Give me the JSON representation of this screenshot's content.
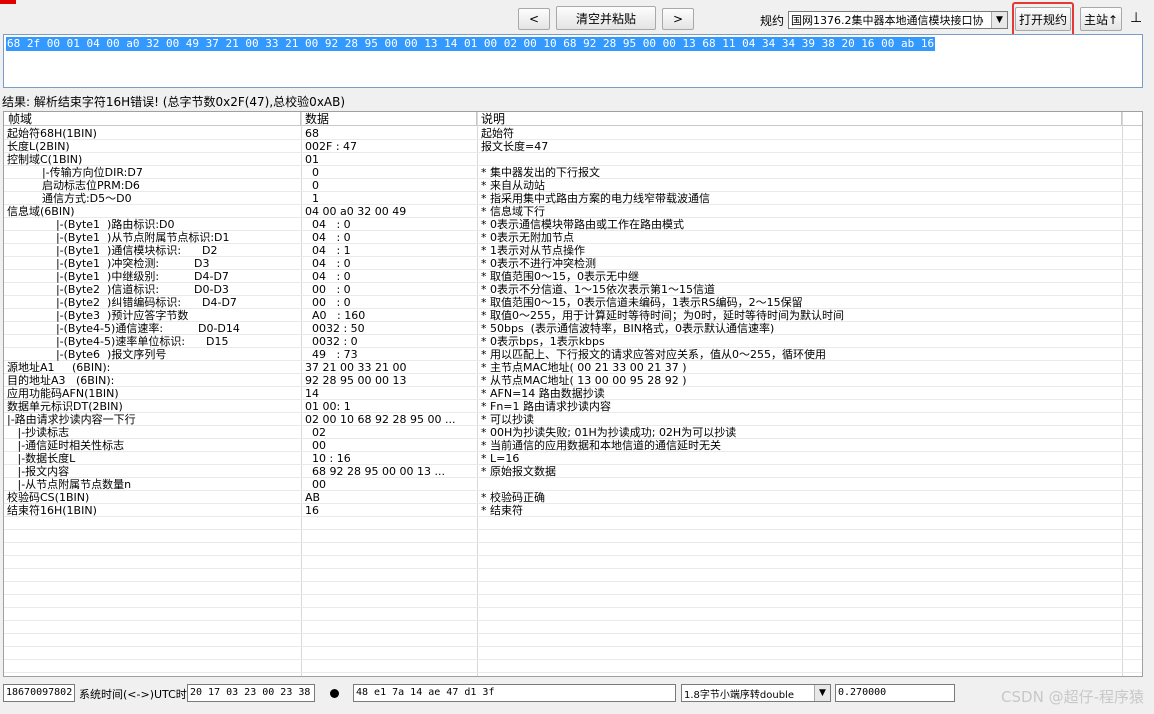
{
  "toolbar": {
    "prev_label": "<",
    "clear_paste_label": "清空并粘贴",
    "next_label": ">",
    "protocol_label": "规约",
    "protocol_value": "国网1376.2集中器本地通信模块接口协",
    "open_protocol_label": "打开规约",
    "main_station_label": "主站↑",
    "pin_label": "⊥"
  },
  "raw": {
    "hex": "68 2f 00 01 04 00 a0 32 00 49 37 21 00 33 21 00 92 28 95 00 00 13 14 01 00 02 00 10 68 92 28 95 00 00 13 68 11 04 34 34 39 38 20 16 00 ab 16"
  },
  "result": {
    "text": "结果: 解析结束字符16H错误! (总字节数0x2F(47),总校验0xAB)"
  },
  "grid": {
    "columns": [
      "帧域",
      "数据",
      "说明"
    ],
    "rows": [
      [
        "起始符68H(1BIN)",
        "68",
        "起始符"
      ],
      [
        "长度L(2BIN)",
        "002F : 47",
        "报文长度=47"
      ],
      [
        "控制域C(1BIN)",
        "01",
        ""
      ],
      [
        "          |-传输方向位DIR:D7",
        "  0",
        "* 集中器发出的下行报文"
      ],
      [
        "          启动标志位PRM:D6",
        "  0",
        "* 来自从动站"
      ],
      [
        "          通信方式:D5～D0",
        "  1",
        "* 指采用集中式路由方案的电力线窄带载波通信"
      ],
      [
        "信息域(6BIN)",
        "04 00 a0 32 00 49",
        "* 信息域下行"
      ],
      [
        "              |-(Byte1  )路由标识:D0",
        "  04   : 0",
        "* 0表示通信模块带路由或工作在路由模式"
      ],
      [
        "              |-(Byte1  )从节点附属节点标识:D1",
        "  04   : 0",
        "* 0表示无附加节点"
      ],
      [
        "              |-(Byte1  )通信模块标识:      D2",
        "  04   : 1",
        "* 1表示对从节点操作"
      ],
      [
        "              |-(Byte1  )冲突检测:          D3",
        "  04   : 0",
        "* 0表示不进行冲突检测"
      ],
      [
        "              |-(Byte1  )中继级别:          D4-D7",
        "  04   : 0",
        "* 取值范围0～15，0表示无中继"
      ],
      [
        "              |-(Byte2  )信道标识:          D0-D3",
        "  00   : 0",
        "* 0表示不分信道、1～15依次表示第1～15信道"
      ],
      [
        "              |-(Byte2  )纠错编码标识:      D4-D7",
        "  00   : 0",
        "* 取值范围0～15，0表示信道未编码，1表示RS编码，2～15保留"
      ],
      [
        "              |-(Byte3  )预计应答字节数",
        "  A0   : 160",
        "* 取值0～255，用于计算延时等待时间；为0时，延时等待时间为默认时间"
      ],
      [
        "              |-(Byte4-5)通信速率:          D0-D14",
        "  0032 : 50",
        "* 50bps  (表示通信波特率，BIN格式，0表示默认通信速率)"
      ],
      [
        "              |-(Byte4-5)速率单位标识:      D15",
        "  0032 : 0",
        "* 0表示bps，1表示kbps"
      ],
      [
        "              |-(Byte6  )报文序列号",
        "  49   : 73",
        "* 用以匹配上、下行报文的请求应答对应关系，值从0～255，循环使用"
      ],
      [
        "源地址A1     (6BIN):",
        "37 21 00 33 21 00",
        "* 主节点MAC地址( 00 21 33 00 21 37 )"
      ],
      [
        "目的地址A3   (6BIN):",
        "92 28 95 00 00 13",
        "* 从节点MAC地址( 13 00 00 95 28 92 )"
      ],
      [
        "应用功能码AFN(1BIN)",
        "14",
        "* AFN=14 路由数据抄读"
      ],
      [
        "数据单元标识DT(2BIN)",
        "01 00: 1",
        "* Fn=1 路由请求抄读内容"
      ],
      [
        "|-路由请求抄读内容一下行",
        "02 00 10 68 92 28 95 00 ...",
        "* 可以抄读"
      ],
      [
        "   |-抄读标志",
        "  02",
        "* 00H为抄读失败; 01H为抄读成功; 02H为可以抄读"
      ],
      [
        "   |-通信延时相关性标志",
        "  00",
        "* 当前通信的应用数据和本地信道的通信延时无关"
      ],
      [
        "   |-数据长度L",
        "  10 : 16",
        "* L=16"
      ],
      [
        "   |-报文内容",
        "  68 92 28 95 00 00 13 ...",
        "* 原始报文数据"
      ],
      [
        "   |-从节点附属节点数量n",
        "  00",
        ""
      ],
      [
        "校验码CS(1BIN)",
        "AB",
        "* 校验码正确"
      ],
      [
        "结束符16H(1BIN)",
        "16",
        "* 结束符"
      ]
    ]
  },
  "status": {
    "phone": "18670097802",
    "time_label": "系统时间(<->)UTC时间",
    "time_value": "20 17 03 23 00 23 38",
    "hex_value": "48 e1 7a 14 ae 47 d1 3f",
    "convert_mode": "1.8字节小端序转double",
    "double_value": "0.270000",
    "watermark": "CSDN @超仔-程序猿"
  }
}
